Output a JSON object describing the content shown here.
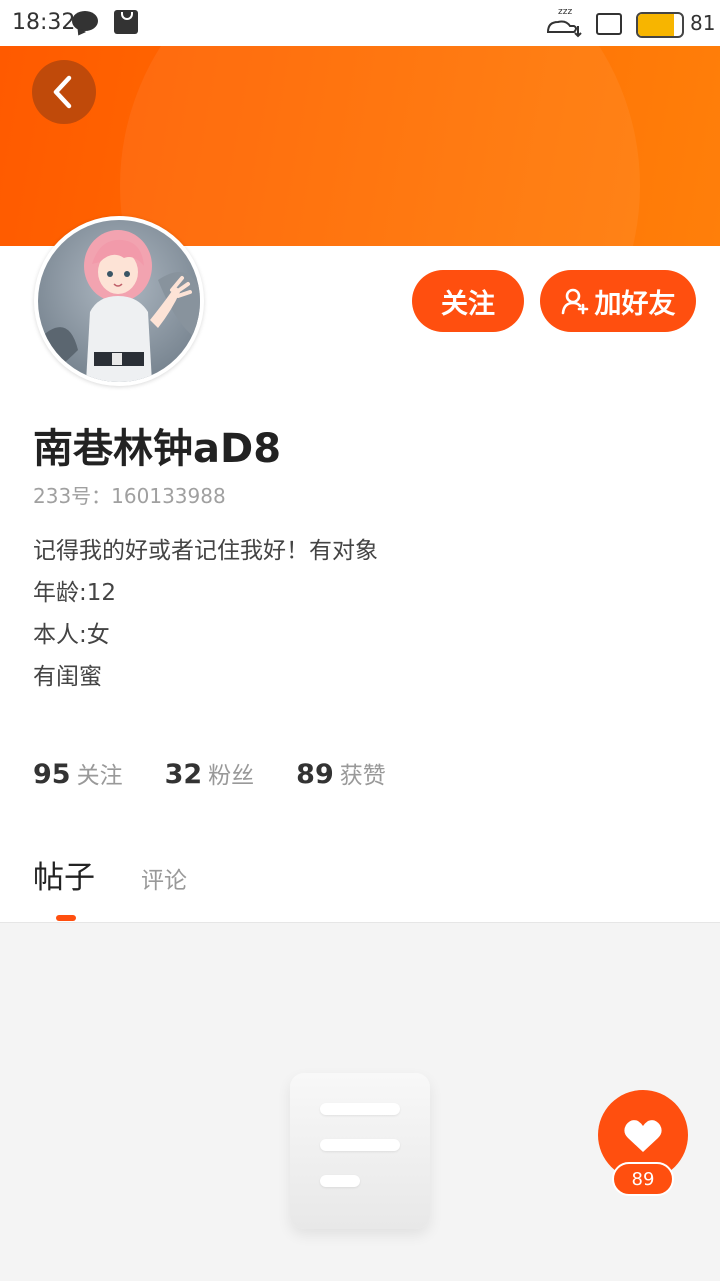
{
  "status_bar": {
    "time": "18:32",
    "battery_level": 0.81,
    "battery_text": "81",
    "icons": [
      "chat-bubble-icon",
      "shopping-bag-icon",
      "sleep-icon",
      "sim-icon",
      "battery-icon"
    ]
  },
  "header": {
    "back_icon": "chevron-left-icon",
    "banner_color": "#ff6a00"
  },
  "profile": {
    "username": "南巷林钟aD8",
    "uid": "233号：160133988",
    "bio": [
      "记得我的好或者记住我好！有对象",
      "年龄:12",
      "本人:女",
      "有闺蜜"
    ]
  },
  "actions": {
    "follow_label": "关注",
    "add_friend_label": "加好友",
    "add_friend_icon": "add-user-icon"
  },
  "stats": {
    "following_count": "95",
    "following_label": "关注",
    "fans_count": "32",
    "fans_label": "粉丝",
    "likes_count": "89",
    "likes_label": "获赞"
  },
  "tabs": [
    {
      "label": "帖子",
      "active": true
    },
    {
      "label": "评论",
      "active": false
    }
  ],
  "floating": {
    "like_icon": "heart-icon",
    "like_count": "89"
  },
  "colors": {
    "accent": "#ff4f0f",
    "background": "#f4f4f4"
  }
}
